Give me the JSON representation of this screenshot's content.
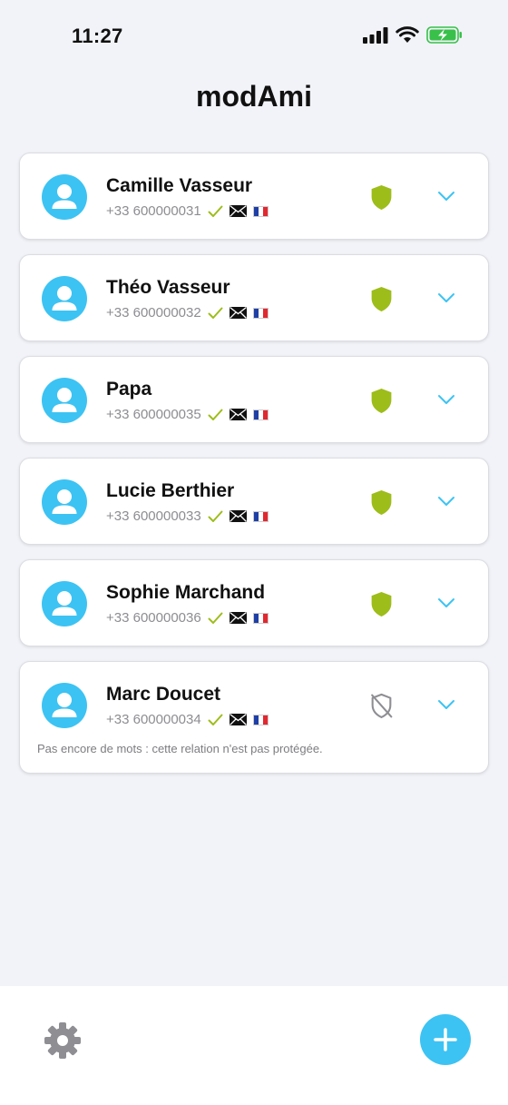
{
  "status_bar": {
    "time": "11:27"
  },
  "app": {
    "title": "modAmi"
  },
  "colors": {
    "accent": "#3cc3f3",
    "protected": "#9dbd1a",
    "unprotected": "#8e8e93",
    "check": "#9dbd1a"
  },
  "contacts": [
    {
      "name": "Camille Vasseur",
      "phone": "+33 600000031",
      "protected": true,
      "note": ""
    },
    {
      "name": "Théo Vasseur",
      "phone": "+33 600000032",
      "protected": true,
      "note": ""
    },
    {
      "name": "Papa",
      "phone": "+33 600000035",
      "protected": true,
      "note": ""
    },
    {
      "name": "Lucie Berthier",
      "phone": "+33 600000033",
      "protected": true,
      "note": ""
    },
    {
      "name": "Sophie Marchand",
      "phone": "+33 600000036",
      "protected": true,
      "note": ""
    },
    {
      "name": "Marc Doucet",
      "phone": "+33 600000034",
      "protected": false,
      "note": "Pas encore de mots : cette relation n'est pas protégée."
    }
  ],
  "icons": {
    "avatar": "person-icon",
    "verified": "check-icon",
    "email": "envelope-icon",
    "country": "flag-fr-icon",
    "protected": "shield-icon",
    "unprotected": "shield-slash-icon",
    "expand": "chevron-down-icon",
    "settings": "gear-icon",
    "add": "plus-icon"
  }
}
